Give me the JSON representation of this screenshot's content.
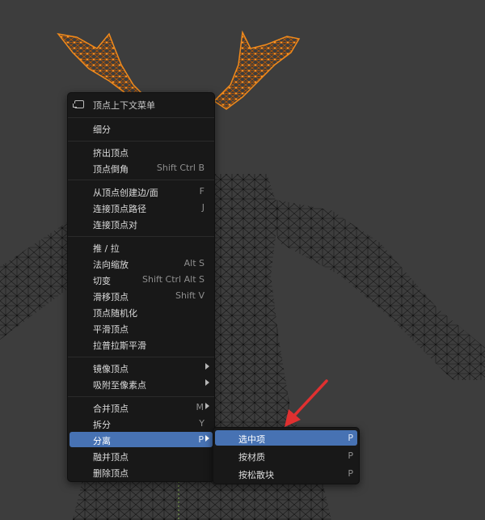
{
  "context_menu": {
    "title": "顶点上下文菜单",
    "items": [
      {
        "label": "细分",
        "shortcut": ""
      },
      {
        "label": "挤出顶点",
        "shortcut": ""
      },
      {
        "label": "顶点倒角",
        "shortcut": "Shift Ctrl B"
      },
      {
        "label": "从顶点创建边/面",
        "shortcut": "F"
      },
      {
        "label": "连接顶点路径",
        "shortcut": "J"
      },
      {
        "label": "连接顶点对",
        "shortcut": ""
      },
      {
        "label": "推 / 拉",
        "shortcut": ""
      },
      {
        "label": "法向缩放",
        "shortcut": "Alt S"
      },
      {
        "label": "切变",
        "shortcut": "Shift Ctrl Alt S"
      },
      {
        "label": "滑移顶点",
        "shortcut": "Shift V"
      },
      {
        "label": "顶点随机化",
        "shortcut": ""
      },
      {
        "label": "平滑顶点",
        "shortcut": ""
      },
      {
        "label": "拉普拉斯平滑",
        "shortcut": ""
      },
      {
        "label": "镜像顶点",
        "shortcut": ""
      },
      {
        "label": "吸附至像素点",
        "shortcut": ""
      },
      {
        "label": "合并顶点",
        "shortcut": "M"
      },
      {
        "label": "拆分",
        "shortcut": "Y"
      },
      {
        "label": "分离",
        "shortcut": "P"
      },
      {
        "label": "融并顶点",
        "shortcut": ""
      },
      {
        "label": "删除顶点",
        "shortcut": ""
      }
    ]
  },
  "separate_submenu": {
    "items": [
      {
        "label": "选中项",
        "shortcut": "P"
      },
      {
        "label": "按材质",
        "shortcut": "P"
      },
      {
        "label": "按松散块",
        "shortcut": "P"
      }
    ]
  },
  "colors": {
    "viewport_bg": "#3d3d3d",
    "menu_bg": "#181818",
    "highlight": "#4772b3",
    "selected_mesh": "#f08a1c",
    "annotation_arrow": "#e03030"
  }
}
